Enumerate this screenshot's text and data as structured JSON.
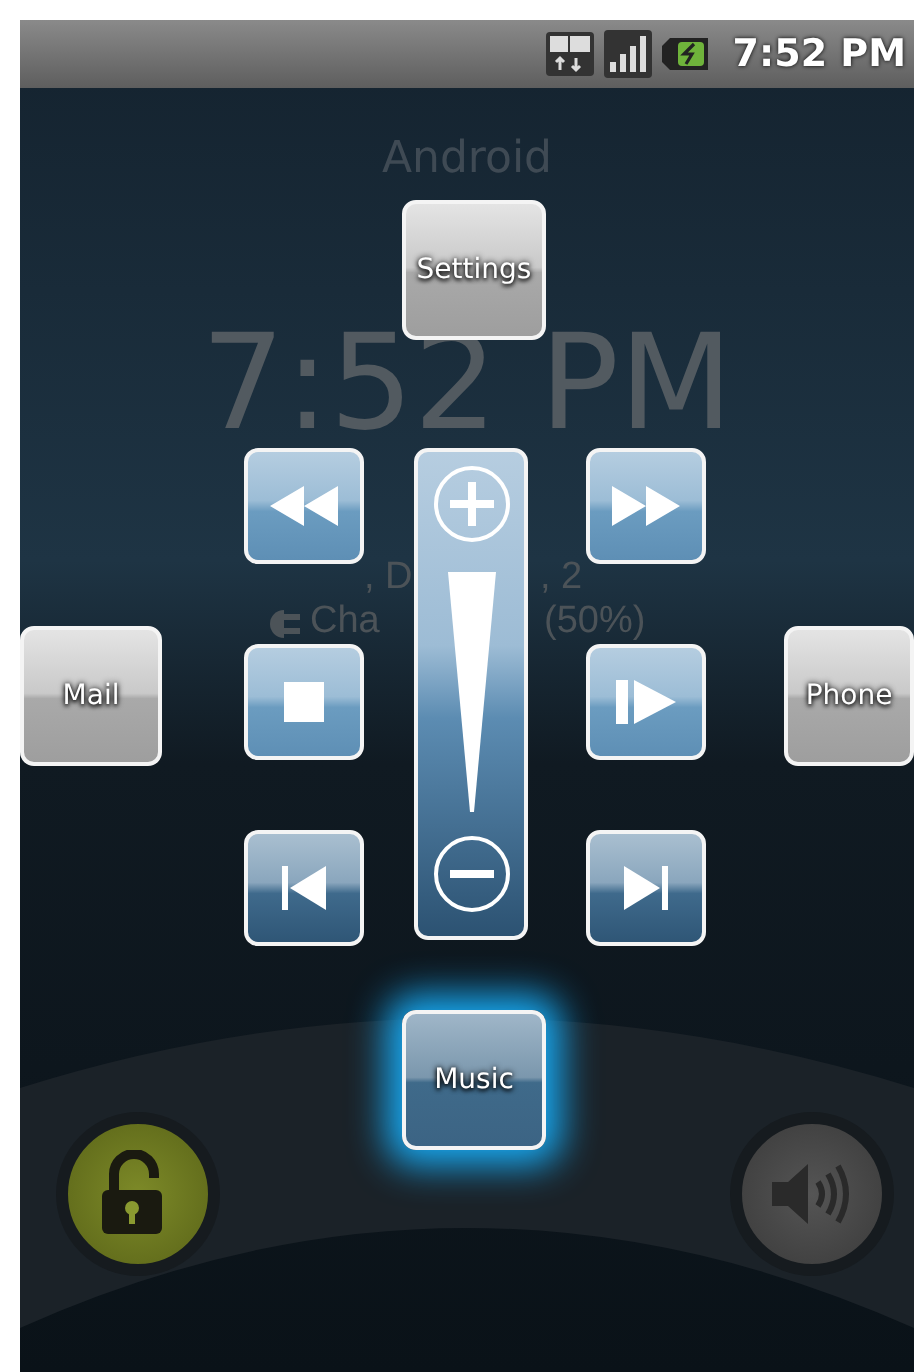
{
  "status_bar": {
    "time": "7:52 PM"
  },
  "lock_screen": {
    "carrier": "Android",
    "clock": "7:52 PM",
    "date_fragments": [
      ", D",
      ", 2"
    ],
    "charging_fragments": [
      "Cha",
      "(50%)"
    ]
  },
  "shortcuts": [
    {
      "label": "Settings",
      "selected": false
    },
    {
      "label": "Mail",
      "selected": false
    },
    {
      "label": "Phone",
      "selected": false
    },
    {
      "label": "Music",
      "selected": true
    }
  ],
  "media_controls": [
    {
      "kind": "rewind"
    },
    {
      "kind": "fast_forward"
    },
    {
      "kind": "stop"
    },
    {
      "kind": "play_pause"
    },
    {
      "kind": "previous"
    },
    {
      "kind": "next"
    }
  ]
}
